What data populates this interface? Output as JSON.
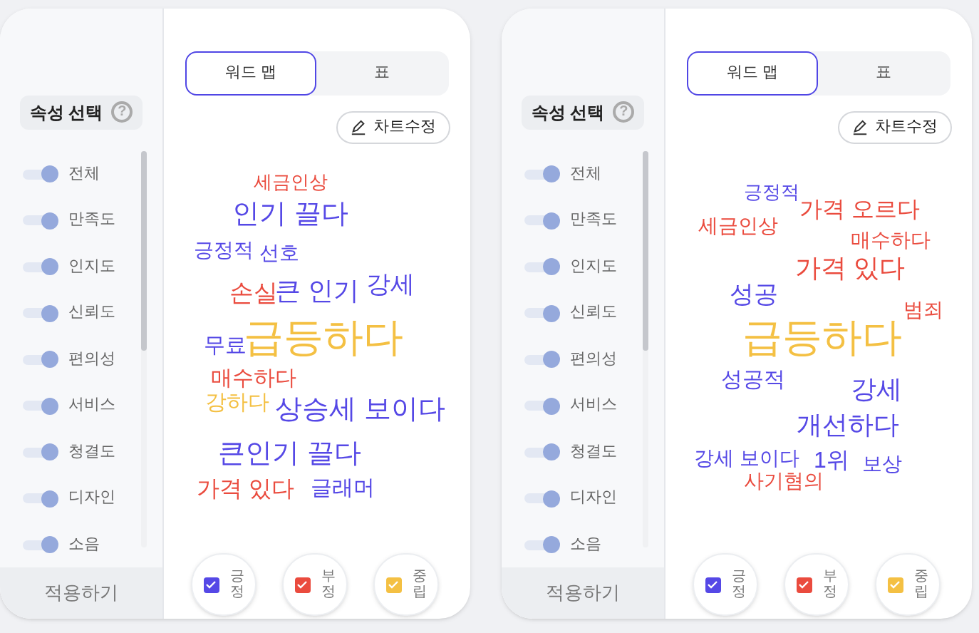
{
  "panels": [
    {
      "sidebar": {
        "title": "속성 선택",
        "help": "?",
        "items": [
          {
            "label": "전체",
            "on": true
          },
          {
            "label": "만족도",
            "on": true
          },
          {
            "label": "인지도",
            "on": true
          },
          {
            "label": "신뢰도",
            "on": true
          },
          {
            "label": "편의성",
            "on": true
          },
          {
            "label": "서비스",
            "on": true
          },
          {
            "label": "청결도",
            "on": true
          },
          {
            "label": "디자인",
            "on": true
          },
          {
            "label": "소음",
            "on": true
          }
        ],
        "apply_button": "적용하기"
      },
      "tabs": [
        {
          "label": "워드 맵",
          "selected": true
        },
        {
          "label": "표",
          "selected": false
        }
      ],
      "edit_button": "차트수정",
      "words": [
        {
          "text": "세금인상",
          "kind": "negative"
        },
        {
          "text": "인기 끌다",
          "kind": "positive"
        },
        {
          "text": "긍정적",
          "kind": "positive"
        },
        {
          "text": "선호",
          "kind": "positive"
        },
        {
          "text": "손실",
          "kind": "negative"
        },
        {
          "text": "큰 인기",
          "kind": "positive"
        },
        {
          "text": "강세",
          "kind": "positive"
        },
        {
          "text": "무료",
          "kind": "positive"
        },
        {
          "text": "급등하다",
          "kind": "neutral"
        },
        {
          "text": "매수하다",
          "kind": "negative"
        },
        {
          "text": "강하다",
          "kind": "neutral"
        },
        {
          "text": "상승세 보이다",
          "kind": "positive"
        },
        {
          "text": "큰인기 끌다",
          "kind": "positive"
        },
        {
          "text": "가격 있다",
          "kind": "negative"
        },
        {
          "text": "글래머",
          "kind": "positive"
        }
      ],
      "legend": [
        {
          "label": "긍정",
          "kind": "positive",
          "checked": true
        },
        {
          "label": "부정",
          "kind": "negative",
          "checked": true
        },
        {
          "label": "중립",
          "kind": "neutral",
          "checked": true
        }
      ]
    },
    {
      "sidebar": {
        "title": "속성 선택",
        "help": "?",
        "items": [
          {
            "label": "전체",
            "on": true
          },
          {
            "label": "만족도",
            "on": true
          },
          {
            "label": "인지도",
            "on": true
          },
          {
            "label": "신뢰도",
            "on": true
          },
          {
            "label": "편의성",
            "on": true
          },
          {
            "label": "서비스",
            "on": true
          },
          {
            "label": "청결도",
            "on": true
          },
          {
            "label": "디자인",
            "on": true
          },
          {
            "label": "소음",
            "on": true
          }
        ],
        "apply_button": "적용하기"
      },
      "tabs": [
        {
          "label": "워드 맵",
          "selected": true
        },
        {
          "label": "표",
          "selected": false
        }
      ],
      "edit_button": "차트수정",
      "words": [
        {
          "text": "긍정적",
          "kind": "positive"
        },
        {
          "text": "가격 오르다",
          "kind": "negative"
        },
        {
          "text": "세금인상",
          "kind": "negative"
        },
        {
          "text": "매수하다",
          "kind": "negative"
        },
        {
          "text": "가격 있다",
          "kind": "negative"
        },
        {
          "text": "성공",
          "kind": "positive"
        },
        {
          "text": "범죄",
          "kind": "negative"
        },
        {
          "text": "급등하다",
          "kind": "neutral"
        },
        {
          "text": "성공적",
          "kind": "positive"
        },
        {
          "text": "강세",
          "kind": "positive"
        },
        {
          "text": "개선하다",
          "kind": "positive"
        },
        {
          "text": "강세 보이다",
          "kind": "positive"
        },
        {
          "text": "1위",
          "kind": "positive"
        },
        {
          "text": "보상",
          "kind": "positive"
        },
        {
          "text": "사기혐의",
          "kind": "negative"
        }
      ],
      "legend": [
        {
          "label": "긍정",
          "kind": "positive",
          "checked": true
        },
        {
          "label": "부정",
          "kind": "negative",
          "checked": true
        },
        {
          "label": "중립",
          "kind": "neutral",
          "checked": true
        }
      ]
    }
  ]
}
